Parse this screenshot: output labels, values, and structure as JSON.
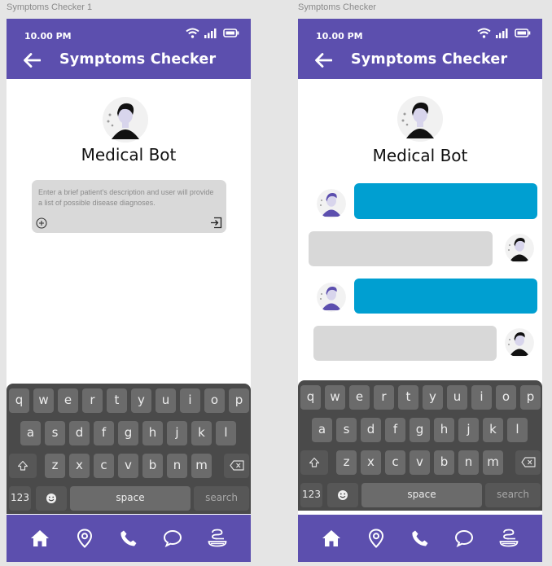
{
  "frames": [
    {
      "label": "Symptoms Checker 1",
      "status_time": "10.00 PM",
      "title": "Symptoms Checker",
      "bot_name": "Medical Bot",
      "input_placeholder": "Enter a brief patient's description and user will provide a list of possible disease diagnoses."
    },
    {
      "label": "Symptoms Checker",
      "status_time": "10.00 PM",
      "title": "Symptoms Checker",
      "bot_name": "Medical Bot",
      "messages": [
        {
          "sender": "bot",
          "text": ""
        },
        {
          "sender": "user",
          "text": ""
        },
        {
          "sender": "bot",
          "text": ""
        },
        {
          "sender": "user",
          "text": ""
        }
      ]
    }
  ],
  "keyboard": {
    "row1": [
      "q",
      "w",
      "e",
      "r",
      "t",
      "y",
      "u",
      "i",
      "o",
      "p"
    ],
    "row2": [
      "a",
      "s",
      "d",
      "f",
      "g",
      "h",
      "j",
      "k",
      "l"
    ],
    "row3": [
      "z",
      "x",
      "c",
      "v",
      "b",
      "n",
      "m"
    ],
    "num_key": "123",
    "space_key": "space",
    "search_key": "search"
  },
  "nav_items": [
    "home-icon",
    "location-icon",
    "phone-icon",
    "chat-icon",
    "medicine-icon"
  ],
  "colors": {
    "primary": "#5c4fae",
    "bot_bubble": "#009fd1",
    "user_bubble": "#d8d8d8",
    "input_bg": "#d9d9d9",
    "keyboard_bg": "#4a4a4a"
  }
}
